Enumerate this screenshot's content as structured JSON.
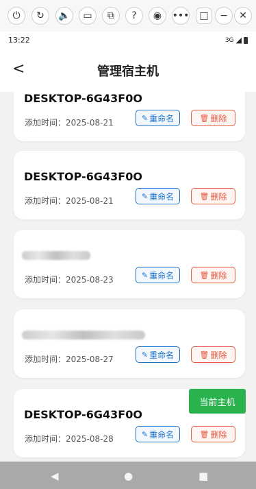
{
  "toolbar": {
    "icons": [
      "power-icon",
      "refresh-icon",
      "volume-icon",
      "folder-icon",
      "share-icon",
      "help-icon",
      "camera-icon",
      "more-icon",
      "restore-icon",
      "minimize-icon",
      "close-icon"
    ]
  },
  "status": {
    "time": "13:22",
    "network": "3G"
  },
  "header": {
    "back_glyph": "<",
    "title": "管理宿主机"
  },
  "actions": {
    "rename_label": "重命名",
    "delete_label": "删除"
  },
  "hosts": [
    {
      "name": "DESKTOP-6G43F0O",
      "added_prefix": "添加时间：",
      "added_date": "2025-08-21"
    },
    {
      "name": "DESKTOP-6G43F0O",
      "added_prefix": "添加时间：",
      "added_date": "2025-08-21"
    },
    {
      "name": "",
      "added_prefix": "添加时间：",
      "added_date": "2025-08-23"
    },
    {
      "name": "",
      "added_prefix": "添加时间：",
      "added_date": "2025-08-27"
    },
    {
      "name": "DESKTOP-6G43F0O",
      "added_prefix": "添加时间：",
      "added_date": "2025-08-28",
      "badge": "当前主机"
    }
  ],
  "colors": {
    "accent_blue": "#1c73c9",
    "danger_red": "#e3573f",
    "current_green": "#2ab24f"
  }
}
